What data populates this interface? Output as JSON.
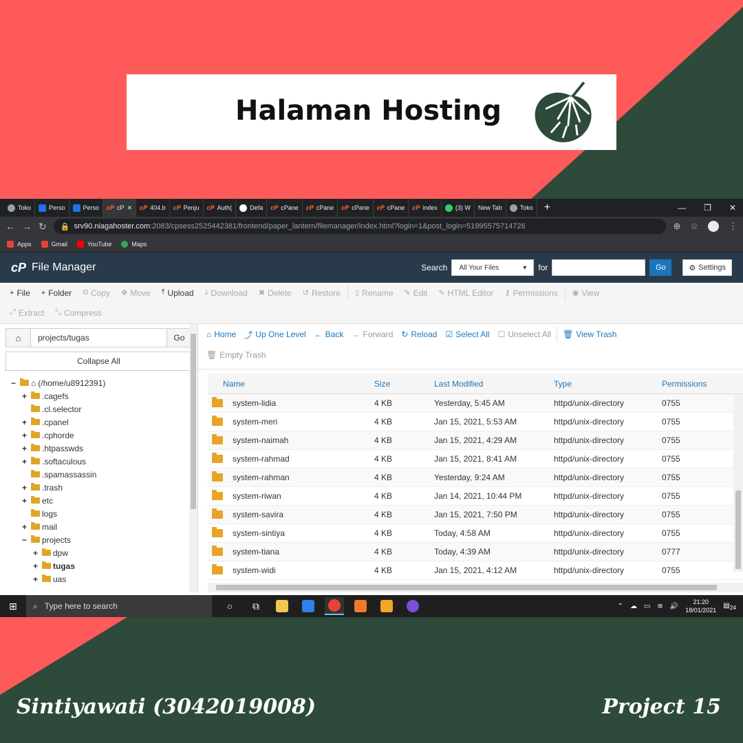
{
  "colors": {
    "coral": "#ff5a5a",
    "forest": "#2d4a3a",
    "banner_bg": "#ffffff",
    "cpanel_header": "#293a4a",
    "link_blue": "#1b75bb",
    "folder": "#e8a329"
  },
  "banner": {
    "title": "Halaman Hosting",
    "icon": "monstera-leaf-icon"
  },
  "browser": {
    "tabs": [
      {
        "label": "Toko",
        "icon": "grey"
      },
      {
        "label": "Perso",
        "icon": "blue"
      },
      {
        "label": "Perso",
        "icon": "blue"
      },
      {
        "label": "cP",
        "icon": "cp",
        "active": true
      },
      {
        "label": "404.b",
        "icon": "cp"
      },
      {
        "label": "Penju",
        "icon": "cp"
      },
      {
        "label": "Auth(",
        "icon": "cp"
      },
      {
        "label": "Defa",
        "icon": "gh"
      },
      {
        "label": "cPane",
        "icon": "cp"
      },
      {
        "label": "cPane",
        "icon": "cp"
      },
      {
        "label": "cPane",
        "icon": "cp"
      },
      {
        "label": "cPane",
        "icon": "cp"
      },
      {
        "label": "index",
        "icon": "cp"
      },
      {
        "label": "(3) W",
        "icon": "wa"
      },
      {
        "label": "New Tab",
        "icon": "none"
      },
      {
        "label": "Toko",
        "icon": "grey"
      }
    ],
    "url_host": "srv90.niagahoster.com",
    "url_rest": ":2083/cpsess2525442381/frontend/paper_lantern/filemanager/index.html?login=1&post_login=51995575714726",
    "bookmarks": [
      "Apps",
      "Gmail",
      "YouTube",
      "Maps"
    ]
  },
  "cpanel": {
    "logo": "cP",
    "title": "File Manager",
    "search_label": "Search",
    "search_scope": "All Your Files",
    "for_label": "for",
    "go_label": "Go",
    "settings_label": "Settings"
  },
  "toolbar": {
    "row1": [
      {
        "icon": "+",
        "label": "File",
        "enabled": true
      },
      {
        "icon": "+",
        "label": "Folder",
        "enabled": true
      },
      {
        "icon": "⧉",
        "label": "Copy",
        "enabled": false
      },
      {
        "icon": "✥",
        "label": "Move",
        "enabled": false
      },
      {
        "icon": "⤒",
        "label": "Upload",
        "enabled": true
      },
      {
        "icon": "⤓",
        "label": "Download",
        "enabled": false
      },
      {
        "icon": "✖",
        "label": "Delete",
        "enabled": false
      },
      {
        "icon": "↺",
        "label": "Restore",
        "enabled": false
      },
      {
        "icon": "▯",
        "label": "Rename",
        "enabled": false
      },
      {
        "icon": "✎",
        "label": "Edit",
        "enabled": false
      },
      {
        "icon": "✎",
        "label": "HTML Editor",
        "enabled": false
      },
      {
        "icon": "⚷",
        "label": "Permissions",
        "enabled": false
      },
      {
        "icon": "◉",
        "label": "View",
        "enabled": false
      }
    ],
    "row2": [
      {
        "icon": "⤢",
        "label": "Extract",
        "enabled": false
      },
      {
        "icon": "⤡",
        "label": "Compress",
        "enabled": false
      }
    ]
  },
  "left_pane": {
    "path_value": "projects/tugas",
    "go_label": "Go",
    "collapse_label": "Collapse All",
    "tree": [
      {
        "label": "(/home/u8912391)",
        "toggle": "−",
        "depth": 0,
        "home": true
      },
      {
        "label": ".cagefs",
        "toggle": "+",
        "depth": 1
      },
      {
        "label": ".cl.selector",
        "toggle": "",
        "depth": 1
      },
      {
        "label": ".cpanel",
        "toggle": "+",
        "depth": 1
      },
      {
        "label": ".cphorde",
        "toggle": "+",
        "depth": 1
      },
      {
        "label": ".htpasswds",
        "toggle": "+",
        "depth": 1
      },
      {
        "label": ".softaculous",
        "toggle": "+",
        "depth": 1
      },
      {
        "label": ".spamassassin",
        "toggle": "",
        "depth": 1
      },
      {
        "label": ".trash",
        "toggle": "+",
        "depth": 1
      },
      {
        "label": "etc",
        "toggle": "+",
        "depth": 1
      },
      {
        "label": "logs",
        "toggle": "",
        "depth": 1
      },
      {
        "label": "mail",
        "toggle": "+",
        "depth": 1
      },
      {
        "label": "projects",
        "toggle": "−",
        "depth": 1
      },
      {
        "label": "dpw",
        "toggle": "+",
        "depth": 2
      },
      {
        "label": "tugas",
        "toggle": "+",
        "depth": 2,
        "bold": true
      },
      {
        "label": "uas",
        "toggle": "+",
        "depth": 2
      }
    ]
  },
  "nav": {
    "row1": [
      {
        "icon": "⌂",
        "label": "Home",
        "enabled": true
      },
      {
        "icon": "⤴",
        "label": "Up One Level",
        "enabled": true
      },
      {
        "icon": "←",
        "label": "Back",
        "enabled": true
      },
      {
        "icon": "→",
        "label": "Forward",
        "enabled": false
      },
      {
        "icon": "↻",
        "label": "Reload",
        "enabled": true
      },
      {
        "icon": "☑",
        "label": "Select All",
        "enabled": true
      },
      {
        "icon": "☐",
        "label": "Unselect All",
        "enabled": false
      },
      {
        "icon": "🗑",
        "label": "View Trash",
        "enabled": true
      }
    ],
    "row2": [
      {
        "icon": "🗑",
        "label": "Empty Trash",
        "enabled": false
      }
    ]
  },
  "table": {
    "headers": {
      "name": "Name",
      "size": "Size",
      "modified": "Last Modified",
      "type": "Type",
      "perms": "Permissions"
    },
    "rows": [
      {
        "name": "system-lidia",
        "size": "4 KB",
        "modified": "Yesterday, 5:45 AM",
        "type": "httpd/unix-directory",
        "perms": "0755"
      },
      {
        "name": "system-meri",
        "size": "4 KB",
        "modified": "Jan 15, 2021, 5:53 AM",
        "type": "httpd/unix-directory",
        "perms": "0755"
      },
      {
        "name": "system-naimah",
        "size": "4 KB",
        "modified": "Jan 15, 2021, 4:29 AM",
        "type": "httpd/unix-directory",
        "perms": "0755"
      },
      {
        "name": "system-rahmad",
        "size": "4 KB",
        "modified": "Jan 15, 2021, 8:41 AM",
        "type": "httpd/unix-directory",
        "perms": "0755"
      },
      {
        "name": "system-rahman",
        "size": "4 KB",
        "modified": "Yesterday, 9:24 AM",
        "type": "httpd/unix-directory",
        "perms": "0755"
      },
      {
        "name": "system-riwan",
        "size": "4 KB",
        "modified": "Jan 14, 2021, 10:44 PM",
        "type": "httpd/unix-directory",
        "perms": "0755"
      },
      {
        "name": "system-savira",
        "size": "4 KB",
        "modified": "Jan 15, 2021, 7:50 PM",
        "type": "httpd/unix-directory",
        "perms": "0755"
      },
      {
        "name": "system-sintiya",
        "size": "4 KB",
        "modified": "Today, 4:58 AM",
        "type": "httpd/unix-directory",
        "perms": "0755"
      },
      {
        "name": "system-tiana",
        "size": "4 KB",
        "modified": "Today, 4:39 AM",
        "type": "httpd/unix-directory",
        "perms": "0777"
      },
      {
        "name": "system-widi",
        "size": "4 KB",
        "modified": "Jan 15, 2021, 4:12 AM",
        "type": "httpd/unix-directory",
        "perms": "0755"
      }
    ]
  },
  "taskbar": {
    "search_placeholder": "Type here to search",
    "time": "21:20",
    "date": "18/01/2021",
    "notif_count": "24"
  },
  "footer": {
    "author": "Sintiyawati (3042019008)",
    "project": "Project 15"
  }
}
